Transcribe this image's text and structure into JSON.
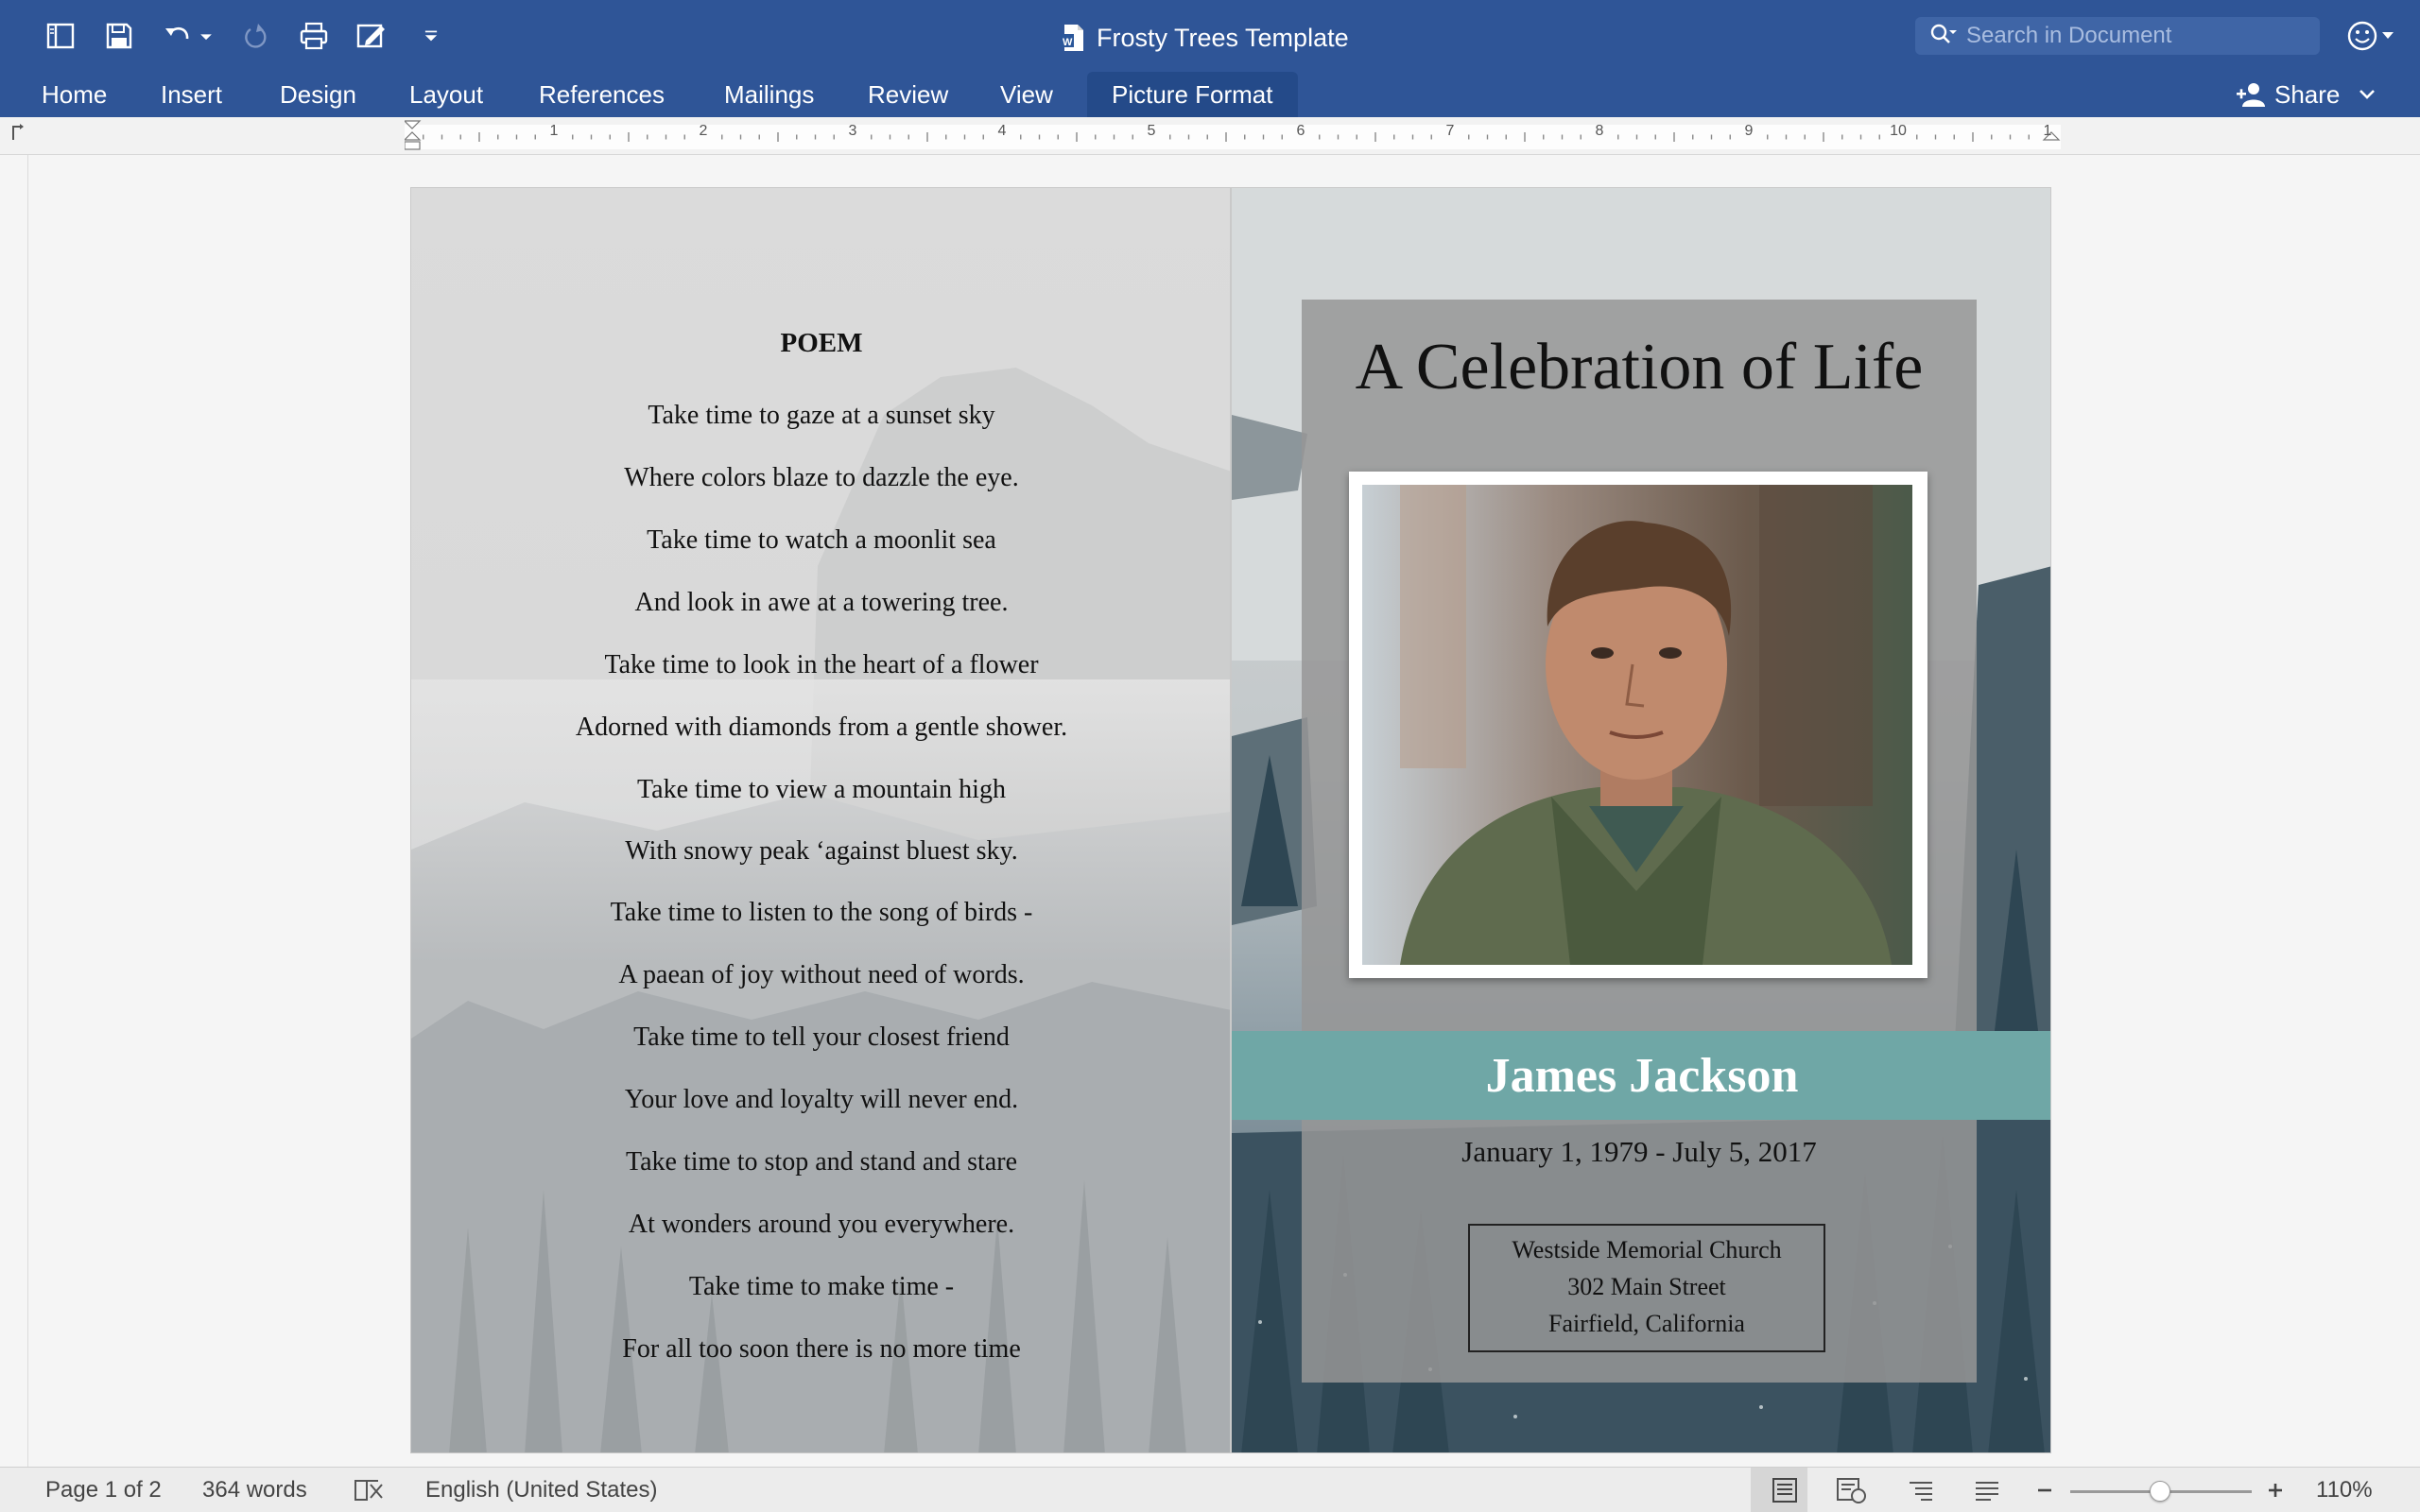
{
  "window": {
    "document_title": "Frosty Trees Template",
    "search_placeholder": "Search in Document"
  },
  "ribbon": {
    "tabs": [
      "Home",
      "Insert",
      "Design",
      "Layout",
      "References",
      "Mailings",
      "Review",
      "View",
      "Picture Format"
    ],
    "active_tab": "Picture Format",
    "share_label": "Share"
  },
  "ruler": {
    "numbers": [
      "1",
      "2",
      "3",
      "4",
      "5",
      "6",
      "7",
      "8",
      "9",
      "10",
      "1"
    ]
  },
  "left_page": {
    "title": "POEM",
    "lines": [
      "Take time to gaze at a sunset sky",
      "Where colors blaze to dazzle the eye.",
      "Take time to watch a moonlit sea",
      "And look in awe at a towering tree.",
      "Take time to look in the heart of a flower",
      "Adorned with diamonds from a gentle shower.",
      "Take time to view a mountain high",
      "With snowy peak ‘against bluest sky.",
      "Take time to listen to the song of birds -",
      "A paean of joy without need of words.",
      "Take time to tell your closest friend",
      "Your love and loyalty will never end.",
      "Take time to stop and stand and stare",
      "At wonders around you everywhere.",
      "Take time to make time -",
      "For all too soon there is no more time"
    ]
  },
  "right_page": {
    "heading": "A Celebration of Life",
    "name": "James  Jackson",
    "dates": "January 1, 1979 - July 5, 2017",
    "venue_line1": "Westside Memorial Church",
    "venue_line2": "302 Main Street",
    "venue_line3": "Fairfield, California",
    "accent_color": "#6fa7a6"
  },
  "status": {
    "page": "Page 1 of 2",
    "words": "364 words",
    "language": "English (United States)",
    "zoom": "110%"
  },
  "colors": {
    "ribbon": "#2f5597",
    "active_tab": "#244a89"
  }
}
